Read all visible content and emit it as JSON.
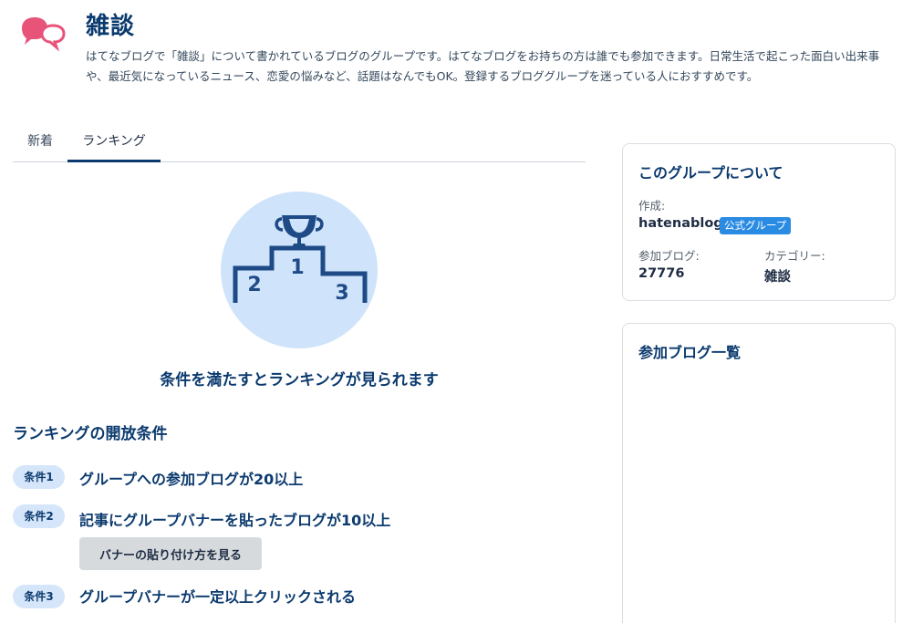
{
  "group": {
    "title": "雑談",
    "description": "はてなブログで「雑談」について書かれているブログのグループです。はてなブログをお持ちの方は誰でも参加できます。日常生活で起こった面白い出来事や、最近気になっているニュース、恋愛の悩みなど、話題はなんでもOK。登録するブロググループを迷っている人におすすめです。"
  },
  "tabs": [
    {
      "label": "新着",
      "active": false
    },
    {
      "label": "ランキング",
      "active": true
    }
  ],
  "ranking": {
    "notice": "条件を満たすとランキングが見られます",
    "podium_labels": [
      "1",
      "2",
      "3"
    ],
    "conditions_heading": "ランキングの開放条件",
    "conditions": [
      {
        "badge": "条件1",
        "text": "グループへの参加ブログが20以上"
      },
      {
        "badge": "条件2",
        "text": "記事にグループバナーを貼ったブログが10以上"
      },
      {
        "badge": "条件3",
        "text": "グループバナーが一定以上クリックされる"
      }
    ],
    "banner_button": "バナーの貼り付け方を見る"
  },
  "sidebar": {
    "about": {
      "title": "このグループについて",
      "creator_label": "作成:",
      "creator": "hatenablog",
      "official_badge": "公式グループ",
      "blogs_label": "参加ブログ:",
      "blogs_count": "27776",
      "category_label": "カテゴリー:",
      "category": "雑談"
    },
    "blog_list": {
      "title": "参加ブログ一覧"
    }
  },
  "colors": {
    "primary": "#0b3a6e",
    "accent_pink": "#e8537a",
    "podium_bg": "#cfe3fb",
    "podium_line": "#1e4a86",
    "badge_bg": "#d6e6fa",
    "official_badge": "#2a8be2"
  }
}
